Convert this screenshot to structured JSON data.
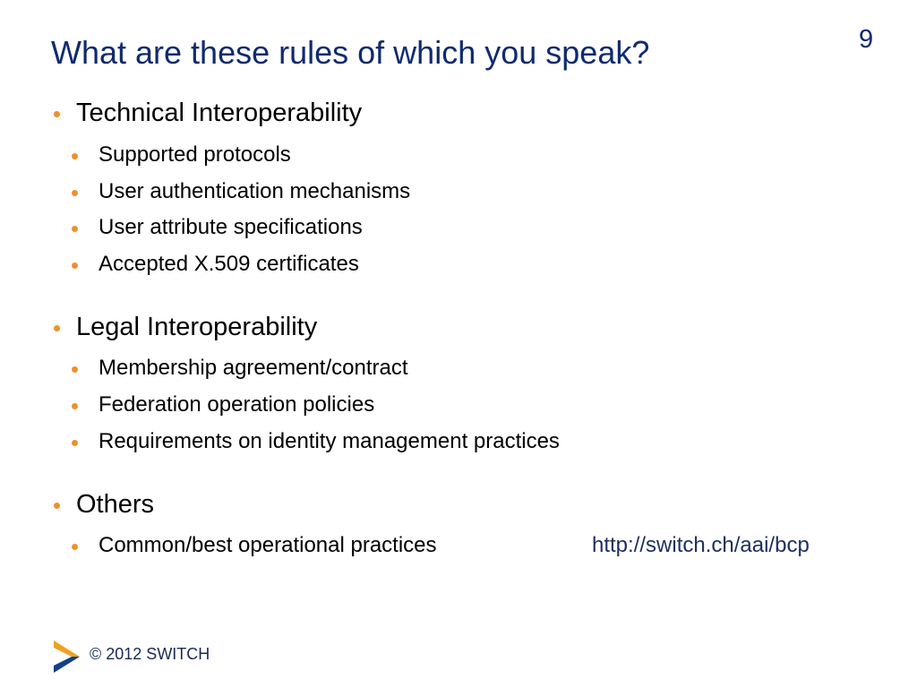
{
  "slide": {
    "title": "What are these rules of which you speak?",
    "page_number": "9",
    "sections": [
      {
        "heading": "Technical Interoperability",
        "items": [
          "Supported protocols",
          "User authentication mechanisms",
          "User attribute specifications",
          "Accepted X.509 certificates"
        ]
      },
      {
        "heading": "Legal Interoperability",
        "items": [
          "Membership agreement/contract",
          "Federation operation policies",
          "Requirements on identity management practices"
        ]
      },
      {
        "heading": "Others",
        "items": [
          "Common/best operational practices"
        ]
      }
    ],
    "link_url": "http://switch.ch/aai/bcp",
    "footer": {
      "copyright": "© 2012 SWITCH",
      "logo_icon": "switch-chevron-logo"
    },
    "colors": {
      "title": "#0f2b6f",
      "bullet": "#f0902a",
      "logo_orange": "#f0a020",
      "logo_blue": "#12408a"
    }
  }
}
